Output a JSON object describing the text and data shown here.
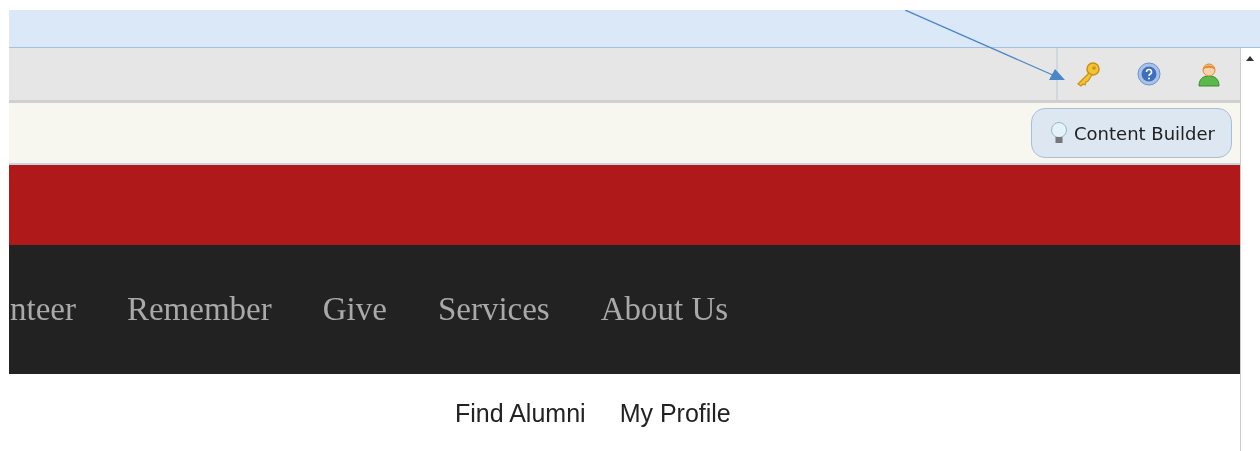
{
  "toolbar": {
    "icons": [
      {
        "kind": "key"
      },
      {
        "kind": "help"
      },
      {
        "kind": "user"
      }
    ]
  },
  "edit_bar": {
    "button": "Content Builder"
  },
  "nav": {
    "items": [
      "nteer",
      "Remember",
      "Give",
      "Services",
      "About Us"
    ]
  },
  "sub_links": [
    "Find Alumni",
    "My Profile"
  ]
}
